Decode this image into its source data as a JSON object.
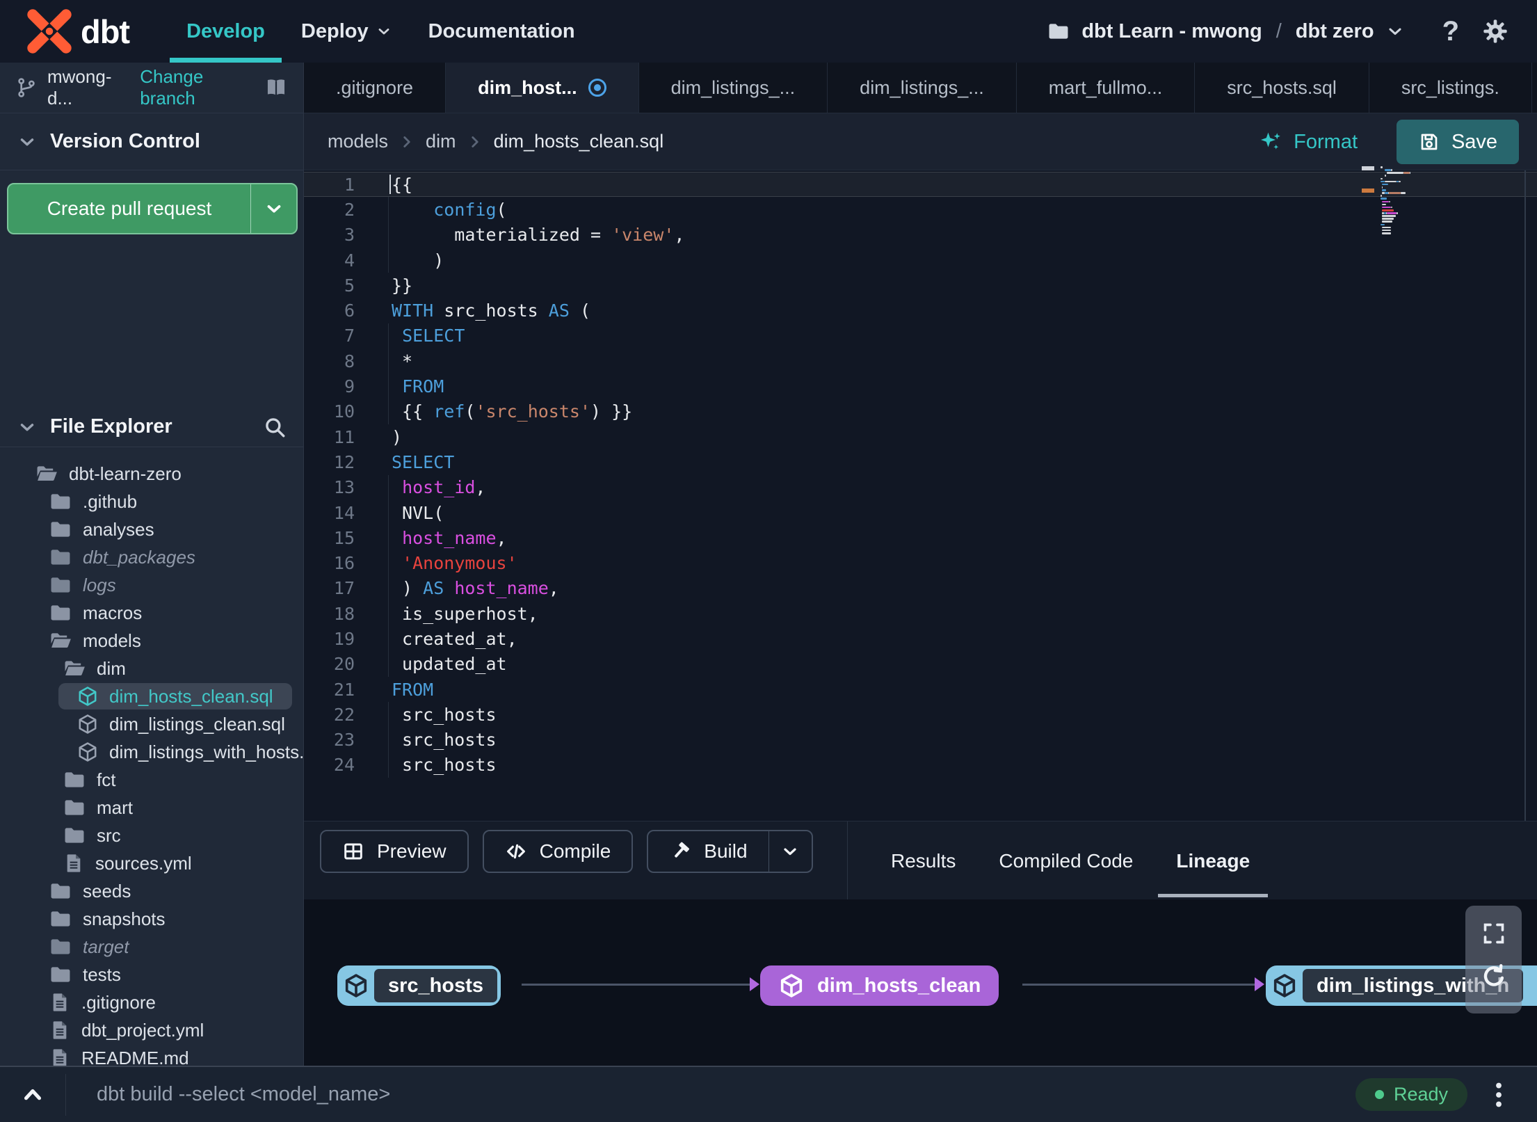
{
  "topnav": {
    "logo_text": "dbt",
    "items": [
      {
        "label": "Develop",
        "active": true
      },
      {
        "label": "Deploy",
        "chevron": true
      },
      {
        "label": "Documentation"
      }
    ],
    "project": {
      "name": "dbt Learn - mwong",
      "separator": "/",
      "env": "dbt zero"
    },
    "help_glyph": "?"
  },
  "branch_bar": {
    "branch": "mwong-d...",
    "change_link": "Change branch"
  },
  "tabs": [
    {
      "label": ".gitignore"
    },
    {
      "label": "dim_host...",
      "active": true,
      "modified": true
    },
    {
      "label": "dim_listings_..."
    },
    {
      "label": "dim_listings_..."
    },
    {
      "label": "mart_fullmo..."
    },
    {
      "label": "src_hosts.sql"
    },
    {
      "label": "src_listings."
    }
  ],
  "add_tab_label": "+",
  "version_control": {
    "title": "Version Control",
    "create_pr_label": "Create pull request"
  },
  "file_explorer": {
    "title": "File Explorer",
    "tree": [
      {
        "name": "dbt-learn-zero",
        "icon": "folder-open",
        "level": 0
      },
      {
        "name": ".github",
        "icon": "folder",
        "level": 1
      },
      {
        "name": "analyses",
        "icon": "folder",
        "level": 1
      },
      {
        "name": "dbt_packages",
        "icon": "folder",
        "level": 1,
        "italic": true
      },
      {
        "name": "logs",
        "icon": "folder",
        "level": 1,
        "italic": true
      },
      {
        "name": "macros",
        "icon": "folder",
        "level": 1
      },
      {
        "name": "models",
        "icon": "folder-open",
        "level": 1
      },
      {
        "name": "dim",
        "icon": "folder-open",
        "level": 2
      },
      {
        "name": "dim_hosts_clean.sql",
        "icon": "model",
        "level": 3,
        "selected": true,
        "dot": true
      },
      {
        "name": "dim_listings_clean.sql",
        "icon": "model",
        "level": 3
      },
      {
        "name": "dim_listings_with_hosts...",
        "icon": "model",
        "level": 3
      },
      {
        "name": "fct",
        "icon": "folder",
        "level": 2
      },
      {
        "name": "mart",
        "icon": "folder",
        "level": 2
      },
      {
        "name": "src",
        "icon": "folder",
        "level": 2
      },
      {
        "name": "sources.yml",
        "icon": "file",
        "level": 2
      },
      {
        "name": "seeds",
        "icon": "folder",
        "level": 1
      },
      {
        "name": "snapshots",
        "icon": "folder",
        "level": 1
      },
      {
        "name": "target",
        "icon": "folder",
        "level": 1,
        "italic": true
      },
      {
        "name": "tests",
        "icon": "folder",
        "level": 1
      },
      {
        "name": ".gitignore",
        "icon": "file",
        "level": 1
      },
      {
        "name": "dbt_project.yml",
        "icon": "file",
        "level": 1
      },
      {
        "name": "README.md",
        "icon": "file",
        "level": 1
      }
    ]
  },
  "breadcrumb": [
    "models",
    "dim",
    "dim_hosts_clean.sql"
  ],
  "editor_actions": {
    "format_label": "Format",
    "save_label": "Save"
  },
  "colors": {
    "accent_teal": "#35c7c7",
    "brand_orange": "#ff5c35",
    "pr_green": "#3f9a64",
    "save_teal": "#28666d",
    "lineage_blue": "#86c7e4",
    "lineage_purple": "#a965d8",
    "ready_green": "#5fd196",
    "tokens": {
      "kw": "#4d9fdb",
      "str": "#c9866b",
      "sqlstr": "#e8433e",
      "col": "#d94fe0",
      "plain": "#e8eaed"
    }
  },
  "editor": {
    "lines": [
      {
        "num": "1",
        "highlight": true,
        "cursor": true,
        "segments": [
          {
            "t": "{{",
            "c": "plain"
          }
        ]
      },
      {
        "num": "2",
        "guide": true,
        "segments": [
          {
            "t": "    ",
            "c": "plain"
          },
          {
            "t": "config",
            "c": "kw"
          },
          {
            "t": "(",
            "c": "plain"
          }
        ]
      },
      {
        "num": "3",
        "guide": true,
        "segments": [
          {
            "t": "      materialized = ",
            "c": "plain"
          },
          {
            "t": "'view'",
            "c": "str"
          },
          {
            "t": ",",
            "c": "plain"
          }
        ]
      },
      {
        "num": "4",
        "guide": true,
        "segments": [
          {
            "t": "    )",
            "c": "plain"
          }
        ]
      },
      {
        "num": "5",
        "segments": [
          {
            "t": "}}",
            "c": "plain"
          }
        ]
      },
      {
        "num": "6",
        "segments": [
          {
            "t": "WITH",
            "c": "kw"
          },
          {
            "t": " src_hosts ",
            "c": "plain"
          },
          {
            "t": "AS",
            "c": "kw"
          },
          {
            "t": " (",
            "c": "plain"
          }
        ]
      },
      {
        "num": "7",
        "guide": true,
        "segments": [
          {
            "t": " ",
            "c": "plain"
          },
          {
            "t": "SELECT",
            "c": "kw"
          }
        ]
      },
      {
        "num": "8",
        "guide": true,
        "segments": [
          {
            "t": " *",
            "c": "plain"
          }
        ]
      },
      {
        "num": "9",
        "guide": true,
        "segments": [
          {
            "t": " ",
            "c": "plain"
          },
          {
            "t": "FROM",
            "c": "kw"
          }
        ]
      },
      {
        "num": "10",
        "guide": true,
        "segments": [
          {
            "t": " {{ ",
            "c": "plain"
          },
          {
            "t": "ref",
            "c": "kw"
          },
          {
            "t": "(",
            "c": "plain"
          },
          {
            "t": "'src_hosts'",
            "c": "str"
          },
          {
            "t": ") }}",
            "c": "plain"
          }
        ]
      },
      {
        "num": "11",
        "segments": [
          {
            "t": ")",
            "c": "plain"
          }
        ]
      },
      {
        "num": "12",
        "segments": [
          {
            "t": "SELECT",
            "c": "kw"
          }
        ]
      },
      {
        "num": "13",
        "guide": true,
        "segments": [
          {
            "t": " ",
            "c": "plain"
          },
          {
            "t": "host_id",
            "c": "col"
          },
          {
            "t": ",",
            "c": "plain"
          }
        ]
      },
      {
        "num": "14",
        "guide": true,
        "segments": [
          {
            "t": " NVL(",
            "c": "plain"
          }
        ]
      },
      {
        "num": "15",
        "guide": true,
        "segments": [
          {
            "t": " ",
            "c": "plain"
          },
          {
            "t": "host_name",
            "c": "col"
          },
          {
            "t": ",",
            "c": "plain"
          }
        ]
      },
      {
        "num": "16",
        "guide": true,
        "segments": [
          {
            "t": " ",
            "c": "plain"
          },
          {
            "t": "'Anonymous'",
            "c": "sqlstr"
          }
        ]
      },
      {
        "num": "17",
        "guide": true,
        "segments": [
          {
            "t": " ) ",
            "c": "plain"
          },
          {
            "t": "AS",
            "c": "kw"
          },
          {
            "t": " ",
            "c": "plain"
          },
          {
            "t": "host_name",
            "c": "col"
          },
          {
            "t": ",",
            "c": "plain"
          }
        ]
      },
      {
        "num": "18",
        "guide": true,
        "segments": [
          {
            "t": " is_superhost,",
            "c": "plain"
          }
        ]
      },
      {
        "num": "19",
        "guide": true,
        "segments": [
          {
            "t": " created_at,",
            "c": "plain"
          }
        ]
      },
      {
        "num": "20",
        "guide": true,
        "segments": [
          {
            "t": " updated_at",
            "c": "plain"
          }
        ]
      },
      {
        "num": "21",
        "segments": [
          {
            "t": "FROM",
            "c": "kw"
          }
        ]
      },
      {
        "num": "22",
        "guide": true,
        "segments": [
          {
            "t": " src_hosts",
            "c": "plain"
          }
        ]
      },
      {
        "num": "23",
        "guide": true,
        "segments": [
          {
            "t": " src_hosts",
            "c": "plain"
          }
        ]
      },
      {
        "num": "24",
        "guide": true,
        "segments": [
          {
            "t": " src_hosts",
            "c": "plain"
          }
        ]
      }
    ]
  },
  "bottom_toolbar": {
    "buttons": [
      {
        "label": "Preview",
        "icon": "grid"
      },
      {
        "label": "Compile",
        "icon": "code"
      },
      {
        "label": "Build",
        "icon": "hammer",
        "split": true
      }
    ],
    "tabs": [
      {
        "label": "Results"
      },
      {
        "label": "Compiled Code"
      },
      {
        "label": "Lineage",
        "active": true
      }
    ]
  },
  "lineage": {
    "nodes": [
      {
        "label": "src_hosts",
        "variant": "source"
      },
      {
        "label": "dim_hosts_clean",
        "variant": "model"
      },
      {
        "label": "dim_listings_with_h",
        "variant": "source"
      }
    ]
  },
  "command_bar": {
    "placeholder": "dbt build --select <model_name>",
    "status": "Ready"
  }
}
